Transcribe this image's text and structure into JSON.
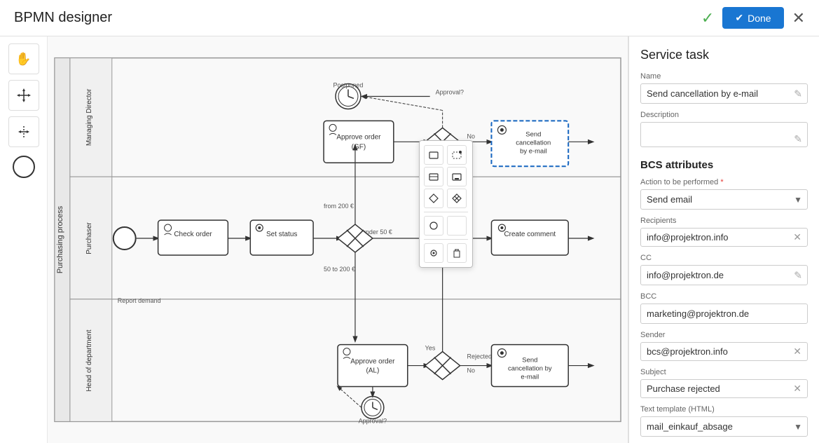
{
  "header": {
    "title": "BPMN designer",
    "done_label": "Done",
    "check_icon": "✓",
    "close_icon": "✕"
  },
  "toolbar": {
    "tools": [
      {
        "name": "hand",
        "icon": "✋",
        "active": false
      },
      {
        "name": "move",
        "icon": "✛",
        "active": false
      },
      {
        "name": "resize",
        "icon": "↔",
        "active": false
      }
    ]
  },
  "diagram": {
    "lanes": [
      {
        "label": "Managing Director"
      },
      {
        "label": "Purchaser"
      },
      {
        "label": "Head of department"
      }
    ],
    "pool_label": "Purchasing process",
    "nodes": []
  },
  "panel": {
    "title": "Service task",
    "name_label": "Name",
    "name_value": "Send cancellation by e-mail",
    "description_label": "Description",
    "description_value": "",
    "bcs_title": "BCS attributes",
    "action_label": "Action to be performed",
    "action_required": true,
    "action_value": "Send email",
    "recipients_label": "Recipients",
    "recipients_value": "info@projektron.info",
    "cc_label": "CC",
    "cc_value": "info@projektron.de",
    "bcc_label": "BCC",
    "bcc_value": "marketing@projektron.de",
    "sender_label": "Sender",
    "sender_value": "bcs@projektron.info",
    "subject_label": "Subject",
    "subject_value": "Purchase rejected",
    "text_template_label": "Text template (HTML)",
    "text_template_value": "mail_einkauf_absage"
  },
  "float_toolbar": {
    "buttons": [
      "□",
      "⬚",
      "⬡",
      "◎",
      "⚡",
      "☰",
      "⚙",
      "🗑"
    ]
  }
}
